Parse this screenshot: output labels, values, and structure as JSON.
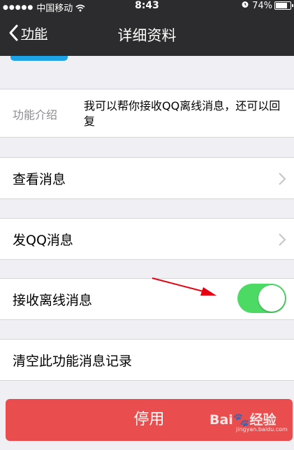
{
  "status_bar": {
    "signal_dots": "●●●●●",
    "carrier": "中国移动",
    "time": "8:43",
    "battery_percent": "74%",
    "battery_level": 0.74
  },
  "nav": {
    "back_label": "功能",
    "title": "详细资料"
  },
  "intro": {
    "label": "功能介绍",
    "value": "我可以帮你接收QQ离线消息，还可以回复"
  },
  "items": [
    {
      "label": "查看消息"
    },
    {
      "label": "发QQ消息"
    },
    {
      "label": "接收离线消息",
      "toggle_on": true
    },
    {
      "label": "清空此功能消息记录"
    }
  ],
  "disable_button": "停用",
  "watermark": {
    "brand": "Bai",
    "brand2": "经验",
    "url": "jingyan.baidu.com"
  },
  "colors": {
    "accent_green": "#4cd964",
    "danger_red": "#ea4d4d",
    "nav_bg": "#2c2c2e",
    "arrow_red": "#e60012"
  }
}
